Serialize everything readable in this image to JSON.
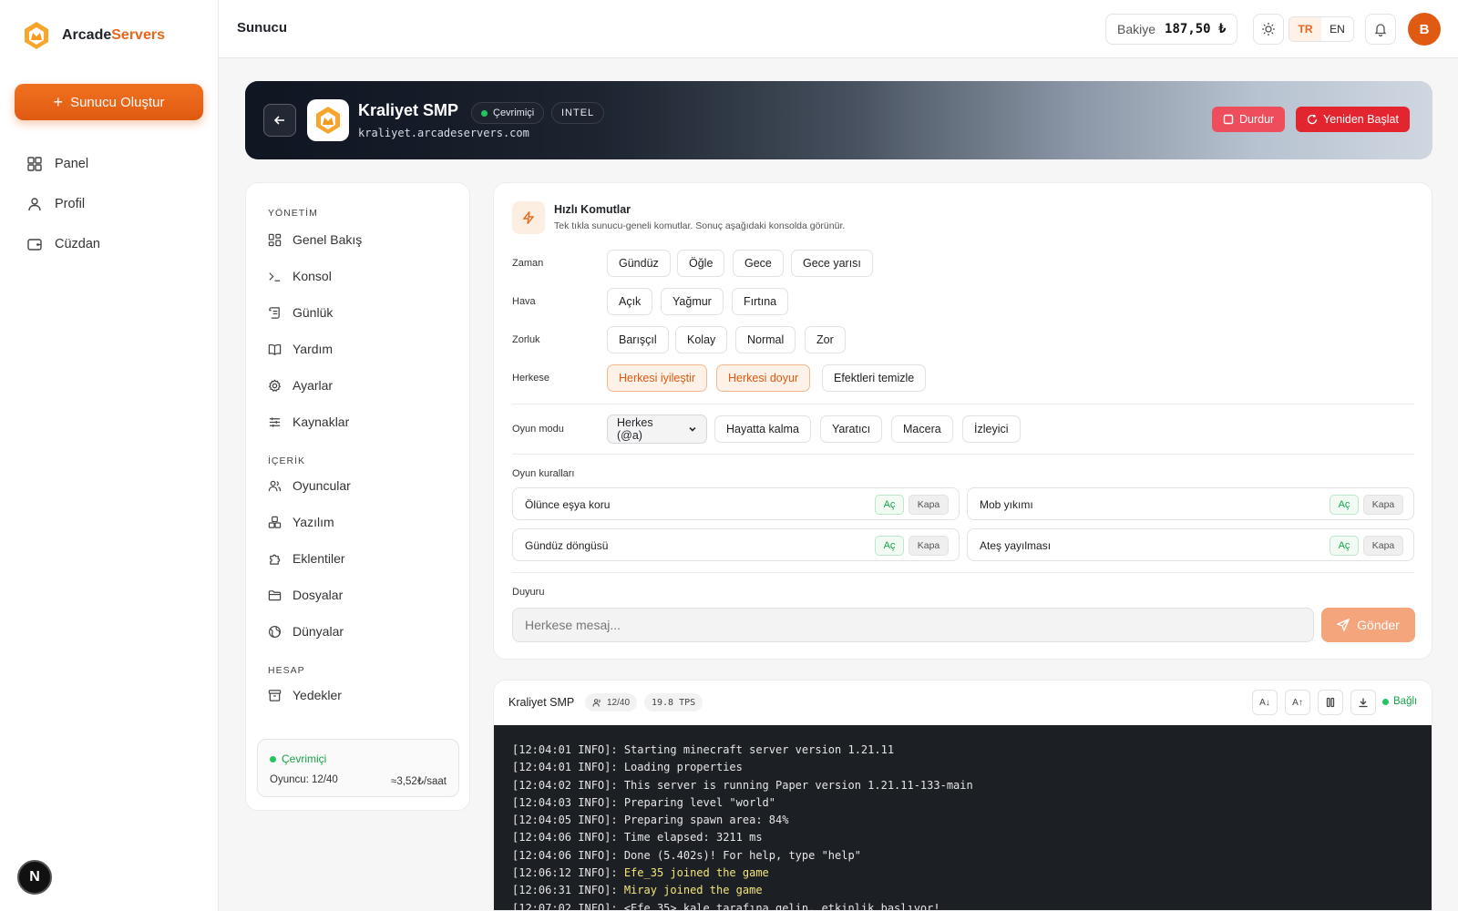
{
  "app": {
    "brand_prefix": "Arcade",
    "brand_suffix": "Servers",
    "create_button": "Sunucu Oluştur",
    "nav": [
      {
        "label": "Panel",
        "icon": "grid-icon"
      },
      {
        "label": "Profil",
        "icon": "user-icon"
      },
      {
        "label": "Cüzdan",
        "icon": "wallet-icon"
      }
    ],
    "footer_badge": "N"
  },
  "header": {
    "title": "Sunucu",
    "balance_label": "Bakiye",
    "balance_amount": "187,50 ₺",
    "lang_tr": "TR",
    "lang_en": "EN",
    "avatar_initial": "B"
  },
  "server": {
    "name": "Kraliyet SMP",
    "status": "Çevrimiçi",
    "cpu_tag": "INTEL",
    "address": "kraliyet.arcadeservers.com",
    "stop_button": "Durdur",
    "restart_button": "Yeniden Başlat"
  },
  "server_nav": {
    "sections": {
      "management": "YÖNETİM",
      "content": "İÇERİK",
      "account": "HESAP"
    },
    "items": [
      {
        "label": "Genel Bakış",
        "icon": "dashboard-icon"
      },
      {
        "label": "Konsol",
        "icon": "terminal-icon"
      },
      {
        "label": "Günlük",
        "icon": "scroll-icon"
      },
      {
        "label": "Yardım",
        "icon": "book-icon"
      },
      {
        "label": "Ayarlar",
        "icon": "gear-icon"
      },
      {
        "label": "Kaynaklar",
        "icon": "sliders-icon"
      },
      {
        "label": "Oyuncular",
        "icon": "users-icon"
      },
      {
        "label": "Yazılım",
        "icon": "boxes-icon"
      },
      {
        "label": "Eklentiler",
        "icon": "puzzle-icon"
      },
      {
        "label": "Dosyalar",
        "icon": "folder-icon"
      },
      {
        "label": "Dünyalar",
        "icon": "globe-icon"
      },
      {
        "label": "Yedekler",
        "icon": "archive-icon"
      }
    ],
    "status_card": {
      "status": "Çevrimiçi",
      "players": "Oyuncu: 12/40",
      "cost": "≈3,52₺/saat"
    }
  },
  "quick_commands": {
    "title": "Hızlı Komutlar",
    "subtitle": "Tek tıkla sunucu-geneli komutlar. Sonuç aşağıdaki konsolda görünür.",
    "rows": [
      {
        "label": "Zaman",
        "chips": [
          "Gündüz",
          "Öğle",
          "Gece",
          "Gece yarısı"
        ]
      },
      {
        "label": "Hava",
        "chips": [
          "Açık",
          "Yağmur",
          "Fırtına"
        ]
      },
      {
        "label": "Zorluk",
        "chips": [
          "Barışçıl",
          "Kolay",
          "Normal",
          "Zor"
        ]
      },
      {
        "label": "Herkese",
        "chips": [
          "Herkesi iyileştir",
          "Herkesi doyur",
          "Efektleri temizle"
        ]
      }
    ],
    "gamemode": {
      "label": "Oyun modu",
      "target": "Herkes (@a)",
      "modes": [
        "Hayatta kalma",
        "Yaratıcı",
        "Macera",
        "İzleyici"
      ]
    },
    "gamerules": {
      "label": "Oyun kuralları",
      "on_label": "Aç",
      "off_label": "Kapa",
      "rules": [
        "Ölünce eşya koru",
        "Mob yıkımı",
        "Gündüz döngüsü",
        "Ateş yayılması"
      ]
    },
    "announcement": {
      "label": "Duyuru",
      "placeholder": "Herkese mesaj...",
      "send": "Gönder"
    }
  },
  "console": {
    "server_name": "Kraliyet SMP",
    "players": "12/40",
    "tps": "19.8 TPS",
    "font_down": "A↓",
    "font_up": "A↑",
    "connected": "Bağlı",
    "lines": [
      {
        "prefix": "[12:04:01 INFO]: ",
        "text": "Starting minecraft server version 1.21.11",
        "highlight": false
      },
      {
        "prefix": "[12:04:01 INFO]: ",
        "text": "Loading properties",
        "highlight": false
      },
      {
        "prefix": "[12:04:02 INFO]: ",
        "text": "This server is running Paper version 1.21.11-133-main",
        "highlight": false
      },
      {
        "prefix": "[12:04:03 INFO]: ",
        "text": "Preparing level \"world\"",
        "highlight": false
      },
      {
        "prefix": "[12:04:05 INFO]: ",
        "text": "Preparing spawn area: 84%",
        "highlight": false
      },
      {
        "prefix": "[12:04:06 INFO]: ",
        "text": "Time elapsed: 3211 ms",
        "highlight": false
      },
      {
        "prefix": "[12:04:06 INFO]: ",
        "text": "Done (5.402s)! For help, type \"help\"",
        "highlight": false
      },
      {
        "prefix": "[12:06:12 INFO]: ",
        "text": "Efe_35 joined the game",
        "highlight": true
      },
      {
        "prefix": "[12:06:31 INFO]: ",
        "text": "Miray joined the game",
        "highlight": true
      },
      {
        "prefix": "[12:07:02 INFO]: ",
        "text": "<Efe_35> kale tarafına gelin, etkinlik başlıyor!",
        "highlight": false
      }
    ]
  },
  "colors": {
    "accent": "#e8651a",
    "danger": "#e2252f",
    "success": "#16a34a",
    "console_bg": "#1c1f24"
  }
}
